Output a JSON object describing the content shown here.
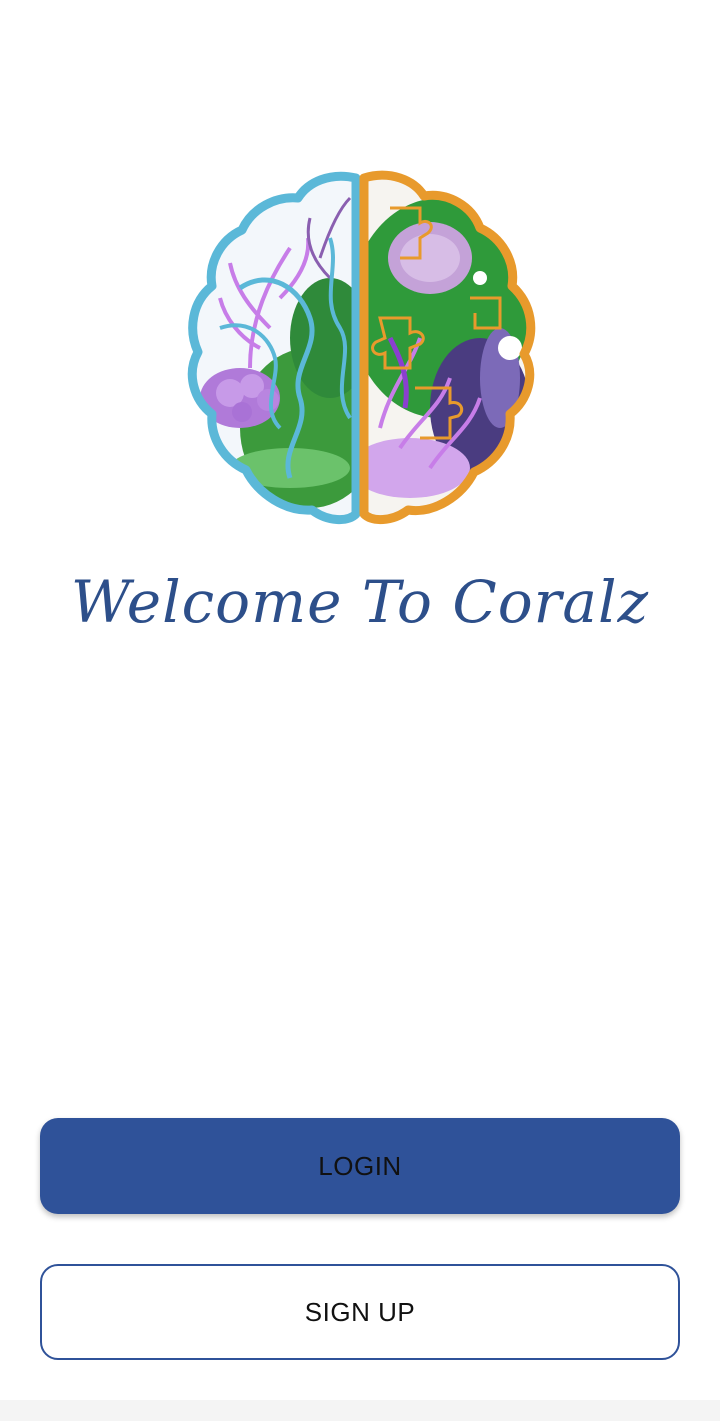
{
  "app": {
    "logo_icon": "coral-brain-logo-icon",
    "welcome_text": "Welcome To Coralz"
  },
  "actions": {
    "login_label": "LOGIN",
    "signup_label": "SIGN UP"
  },
  "colors": {
    "primary": "#2f5299",
    "title": "#2d4f8a",
    "left_brain_outline": "#5bb8d8",
    "right_brain_outline": "#e89a2c"
  }
}
